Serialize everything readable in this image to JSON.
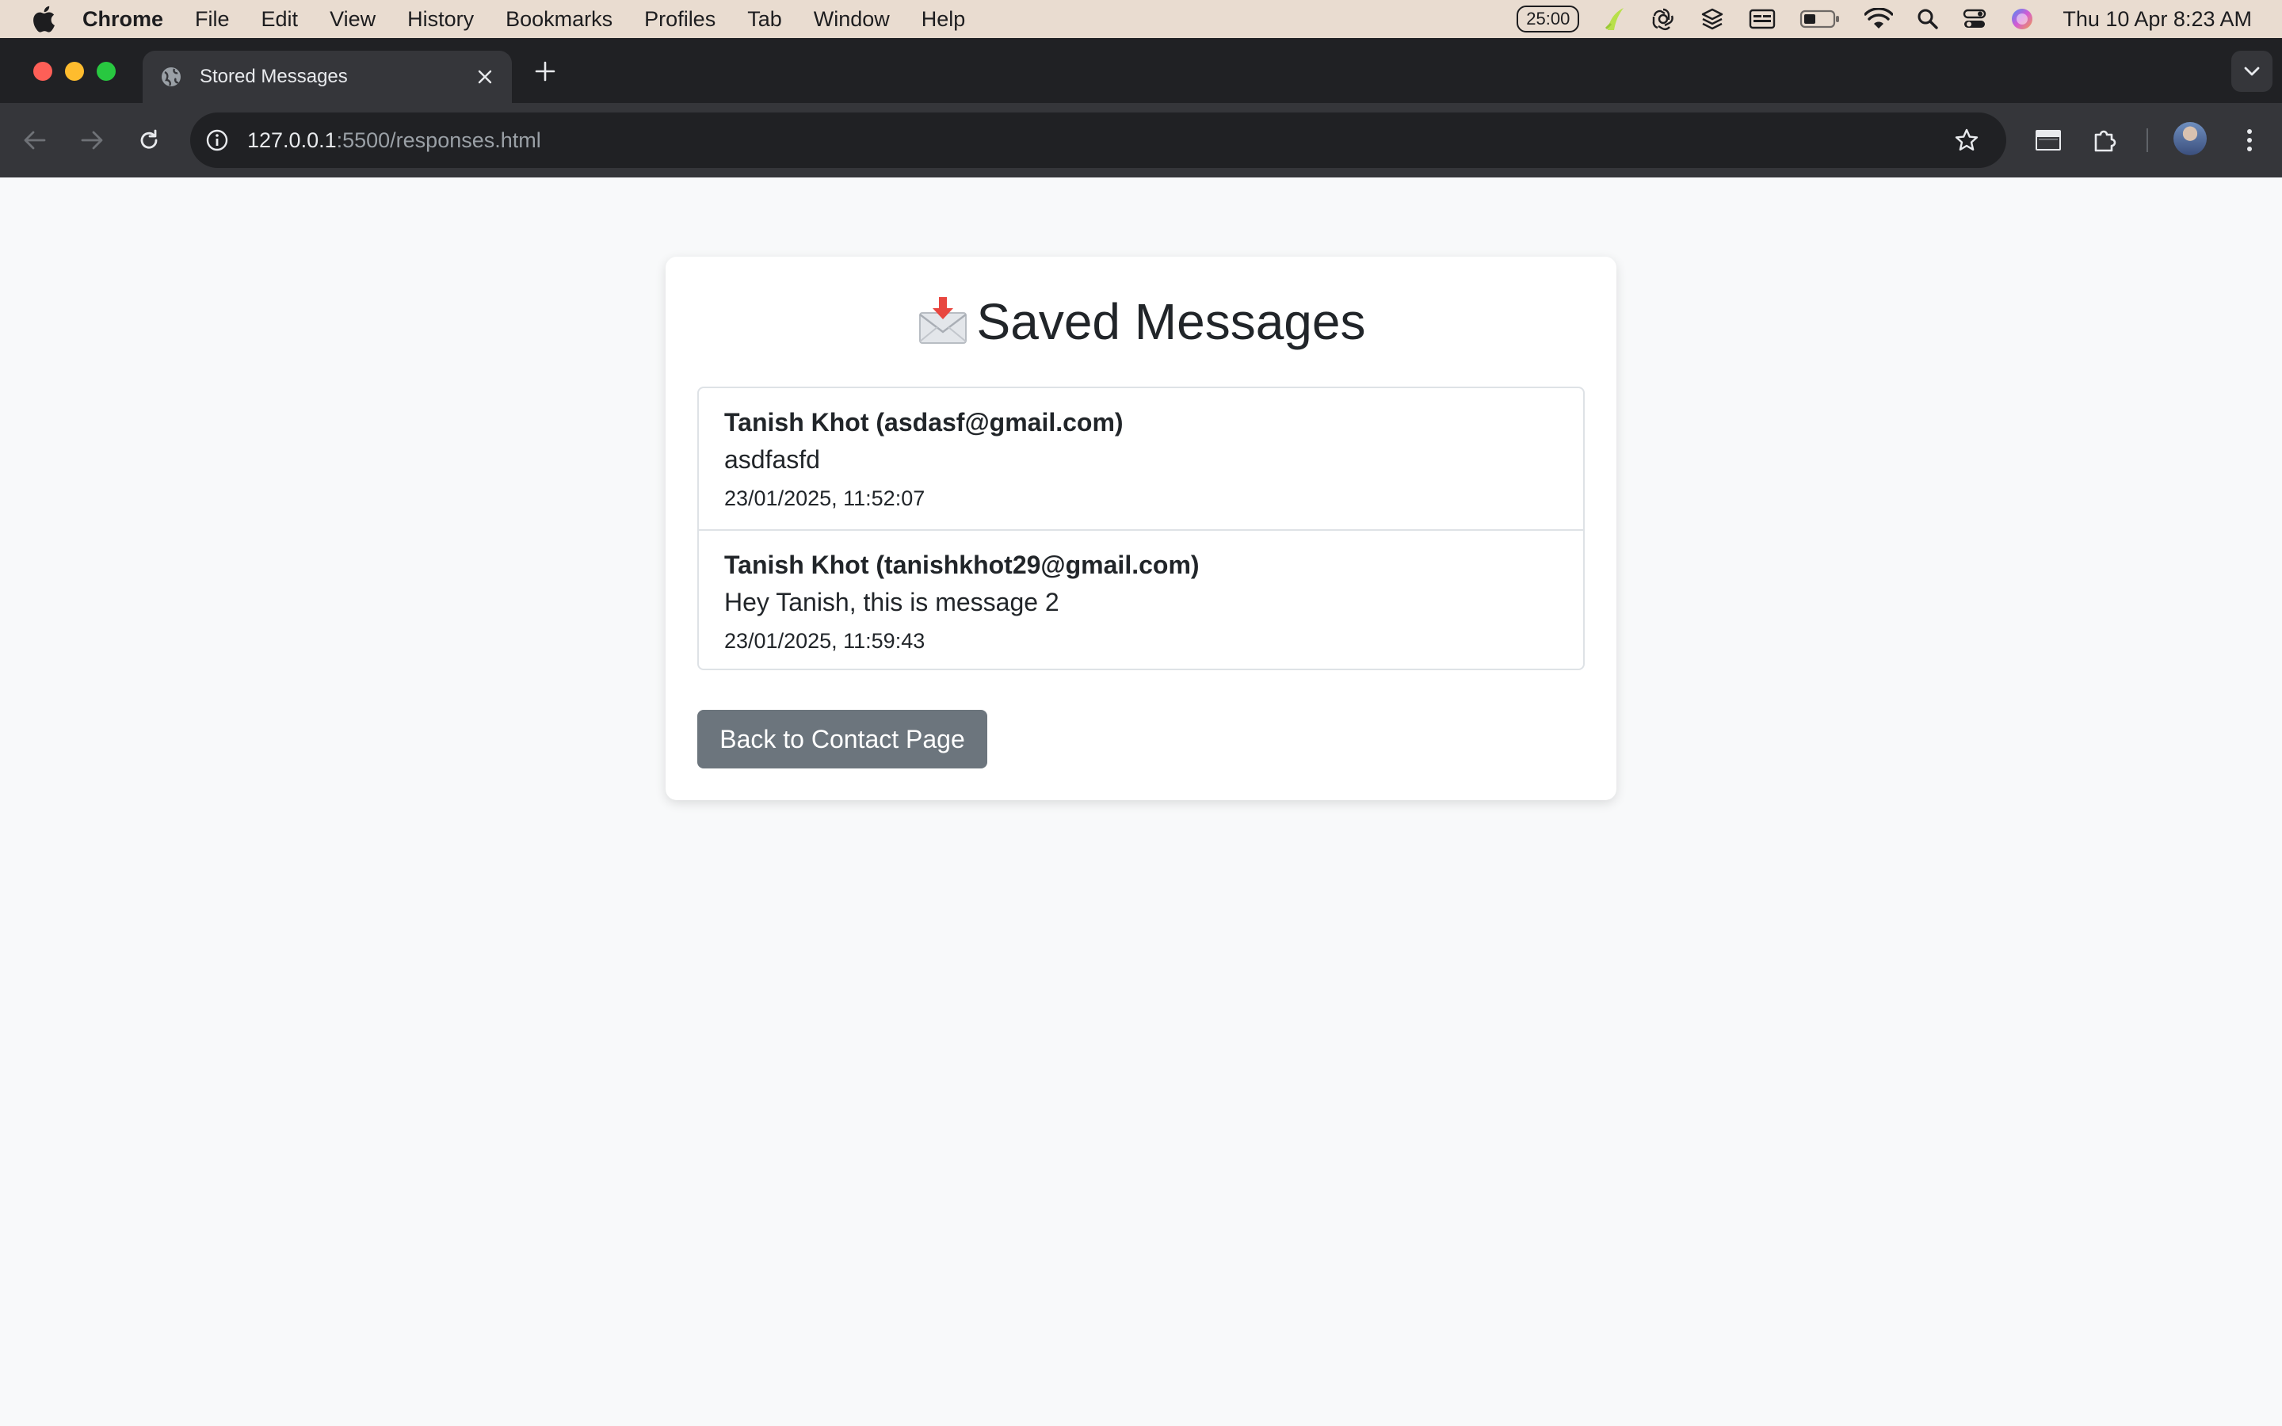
{
  "menubar": {
    "app_name": "Chrome",
    "items": [
      "File",
      "Edit",
      "View",
      "History",
      "Bookmarks",
      "Profiles",
      "Tab",
      "Window",
      "Help"
    ],
    "timer": "25:00",
    "clock": "Thu 10 Apr  8:23 AM",
    "status_icons": [
      "timer-icon",
      "robinhood-icon",
      "chatgpt-icon",
      "layers-icon",
      "display-icon",
      "battery-icon",
      "wifi-icon",
      "spotlight-search-icon",
      "control-center-icon",
      "siri-icon"
    ]
  },
  "browser": {
    "tab_title": "Stored Messages",
    "url_host": "127.0.0.1",
    "url_path": ":5500/responses.html",
    "icons": [
      "globe-icon",
      "close-icon",
      "plus-icon",
      "chevron-down-icon",
      "back-arrow-icon",
      "forward-arrow-icon",
      "reload-icon",
      "info-icon",
      "star-icon",
      "extensions-icon",
      "kebab-menu-icon"
    ]
  },
  "page": {
    "heading_text": "Saved Messages",
    "heading_icon": "incoming-envelope-icon",
    "messages": [
      {
        "sender": "Tanish Khot (asdasf@gmail.com)",
        "body": "asdfasfd",
        "time": "23/01/2025, 11:52:07"
      },
      {
        "sender": "Tanish Khot (tanishkhot29@gmail.com)",
        "body": "Hey Tanish, this is message 2",
        "time": "23/01/2025, 11:59:43"
      }
    ],
    "back_button_label": "Back to Contact Page"
  },
  "colors": {
    "page_background": "#f8f9fa",
    "button_background": "#6c757d",
    "menubar_background": "#e9dcd0",
    "toolbar_background": "#35363a",
    "tabstrip_background": "#202124"
  }
}
